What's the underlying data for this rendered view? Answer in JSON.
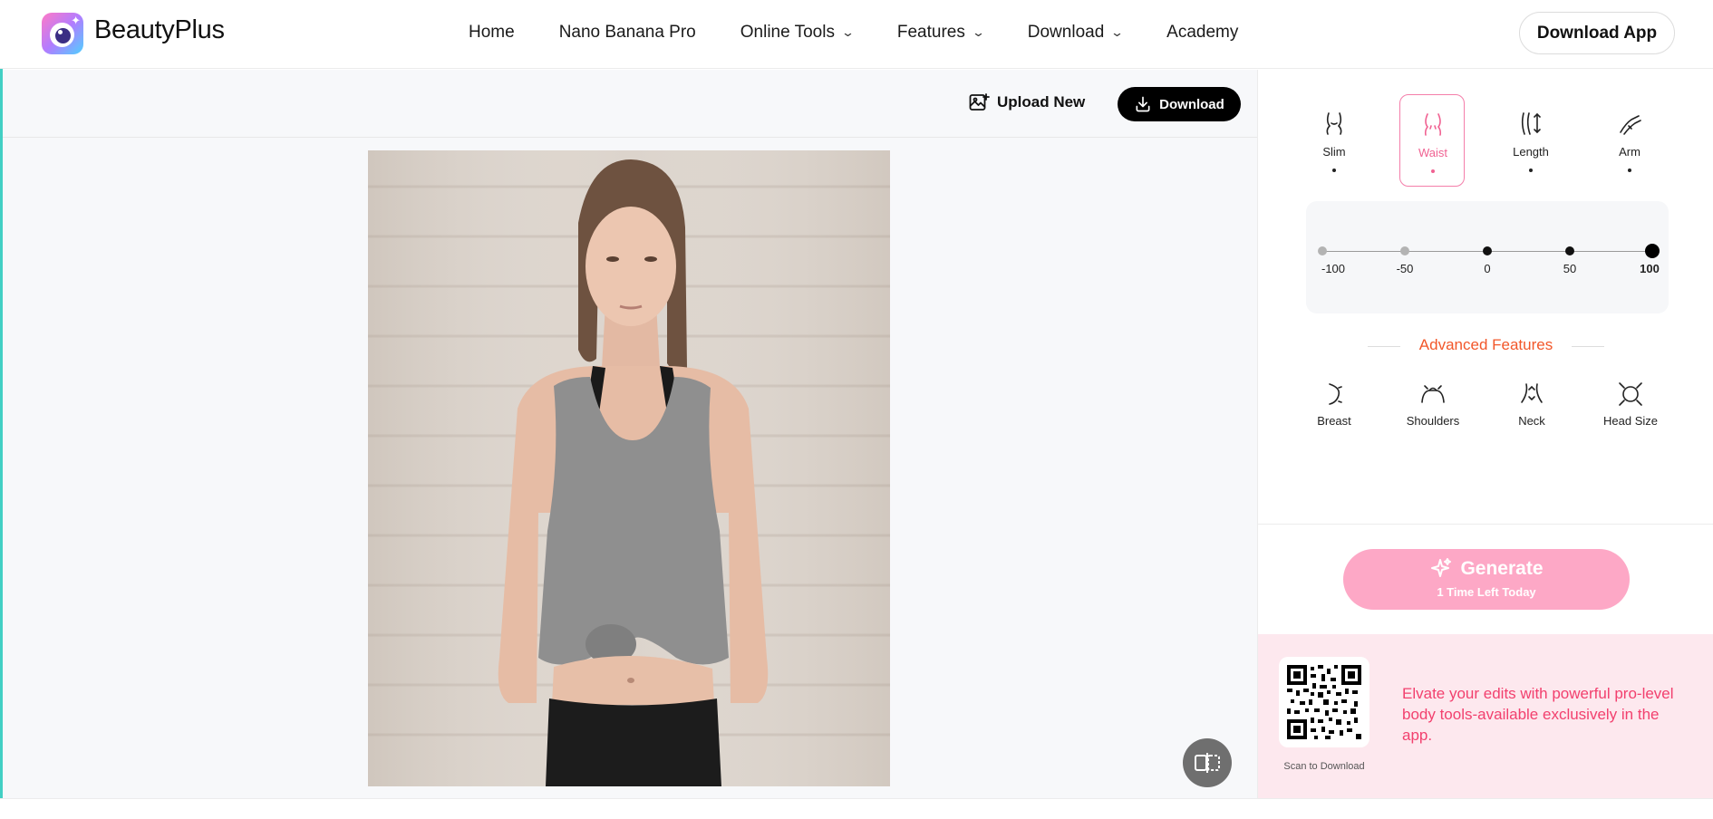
{
  "header": {
    "brand": "BeautyPlus",
    "nav": [
      {
        "label": "Home",
        "has_dropdown": false
      },
      {
        "label": "Nano Banana Pro",
        "has_dropdown": false
      },
      {
        "label": "Online Tools",
        "has_dropdown": true
      },
      {
        "label": "Features",
        "has_dropdown": true
      },
      {
        "label": "Download",
        "has_dropdown": true
      },
      {
        "label": "Academy",
        "has_dropdown": false
      }
    ],
    "download_app_label": "Download App"
  },
  "toolbar": {
    "upload_label": "Upload New",
    "download_label": "Download"
  },
  "body_tools": [
    {
      "label": "Slim",
      "icon": "slim-icon",
      "active": false
    },
    {
      "label": "Waist",
      "icon": "waist-icon",
      "active": true
    },
    {
      "label": "Length",
      "icon": "length-icon",
      "active": false
    },
    {
      "label": "Arm",
      "icon": "arm-icon",
      "active": false
    }
  ],
  "slider": {
    "stops": [
      "-100",
      "-50",
      "0",
      "50",
      "100"
    ],
    "selected": "100"
  },
  "advanced": {
    "title": "Advanced Features",
    "tools": [
      {
        "label": "Breast",
        "icon": "breast-icon"
      },
      {
        "label": "Shoulders",
        "icon": "shoulders-icon"
      },
      {
        "label": "Neck",
        "icon": "neck-icon"
      },
      {
        "label": "Head Size",
        "icon": "head-size-icon"
      }
    ]
  },
  "generate": {
    "label": "Generate",
    "sub_label": "1  Time Left Today"
  },
  "promo": {
    "qr_caption": "Scan to Download",
    "text": "Elvate your edits with powerful pro-level body tools-available exclusively in the app."
  },
  "colors": {
    "accent_pink": "#f06292",
    "generate_bg": "#fda8c6",
    "promo_bg": "#fde8ee",
    "advanced_title": "#f2572a",
    "left_accent": "#42cfc4"
  }
}
